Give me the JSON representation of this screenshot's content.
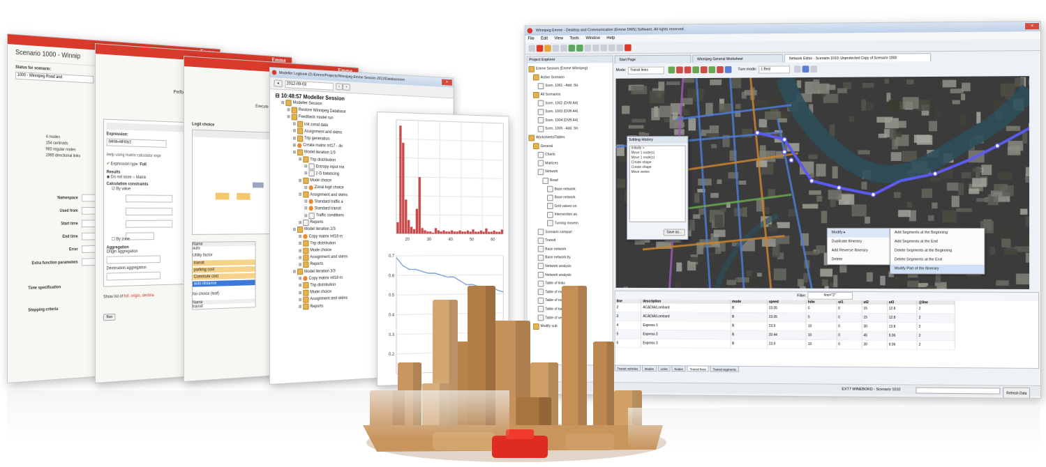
{
  "scenario_panel": {
    "title": "Scenario 1000 - Winnip",
    "status_label": "Status for scenario:",
    "status_value": "1000 - Winnipeg Road and",
    "stats": [
      "4 modes",
      "154 centroids",
      "983 regular nodes",
      "2995 directional links"
    ],
    "fields": [
      "Namespace",
      "Used from",
      "Start time",
      "End time",
      "Error",
      "Extra function parameters"
    ],
    "time_spec": "Time specification",
    "stopping": "Stopping criteria",
    "logo": "Emme"
  },
  "matrix_panel": {
    "header": "Perform matrix calculation",
    "expression_label": "Expression:",
    "expression_value": "(MF68+MF69)/2",
    "help_text": "Help using matrix calculator expr",
    "expression_type": "Expression type:",
    "expression_type_value": "Full",
    "results_label": "Results",
    "result_options": [
      "Do not store",
      "Matrix"
    ],
    "constraints_label": "Calculation constraints",
    "by_value": "By value",
    "by_zone": "By zone",
    "aggregation_label": "Aggregation",
    "origin_agg": "Origin aggregation",
    "dest_agg": "Destination aggregation",
    "footer": "Show list of",
    "footer_links": "full, origin, destina",
    "run_button": "Run"
  },
  "logit_panel": {
    "header": "Execute zonal aggregat",
    "logit_label": "Logit choice",
    "name_col": "Name",
    "auto": "auto",
    "utility": "Utility factor",
    "items": [
      "transit",
      "parking cost",
      "Commute cost",
      "auto distance"
    ],
    "no_choice": "No choice (leaf)",
    "name2": "Name",
    "transit2": "transit"
  },
  "logbook": {
    "title": "Modeller Logbook (D:/Emme/Projects/Winnipeg Emme Session 2012/Database/em",
    "date": "2012-09-03",
    "session": "10:48:57 Modeller Session",
    "rows": [
      {
        "indent": 1,
        "icon": "fold",
        "text": "Modeller Session"
      },
      {
        "indent": 2,
        "icon": "fold",
        "text": "Restore Winnipeg Database"
      },
      {
        "indent": 2,
        "icon": "fold",
        "text": "Feedback model run"
      },
      {
        "indent": 3,
        "icon": "fold",
        "text": "Init zonal data"
      },
      {
        "indent": 3,
        "icon": "fold",
        "text": "Assignment and skims"
      },
      {
        "indent": 3,
        "icon": "fold",
        "text": "Trip generation"
      },
      {
        "indent": 3,
        "icon": "tool",
        "text": "Create matrix mf17 - de"
      },
      {
        "indent": 3,
        "icon": "fold",
        "text": "Model iteration 1/3"
      },
      {
        "indent": 4,
        "icon": "fold",
        "text": "Trip distribution"
      },
      {
        "indent": 5,
        "icon": "box",
        "text": "Entropy input ma"
      },
      {
        "indent": 5,
        "icon": "box",
        "text": "2-D balancing"
      },
      {
        "indent": 4,
        "icon": "fold",
        "text": "Mode choice"
      },
      {
        "indent": 5,
        "icon": "tool",
        "text": "Zonal logit choice"
      },
      {
        "indent": 4,
        "icon": "fold",
        "text": "Assignment and skims"
      },
      {
        "indent": 5,
        "icon": "tool",
        "text": "Standard traffic a"
      },
      {
        "indent": 5,
        "icon": "tool",
        "text": "Standard transit"
      },
      {
        "indent": 5,
        "icon": "box",
        "text": "Traffic conditions"
      },
      {
        "indent": 4,
        "icon": "box",
        "text": "Reports"
      },
      {
        "indent": 3,
        "icon": "fold",
        "text": "Model iteration 2/3"
      },
      {
        "indent": 4,
        "icon": "tool",
        "text": "Copy matrix mf18 m"
      },
      {
        "indent": 4,
        "icon": "fold",
        "text": "Trip distribution"
      },
      {
        "indent": 4,
        "icon": "fold",
        "text": "Mode choice"
      },
      {
        "indent": 4,
        "icon": "fold",
        "text": "Assignment and skims"
      },
      {
        "indent": 4,
        "icon": "fold",
        "text": "Reports"
      },
      {
        "indent": 3,
        "icon": "fold",
        "text": "Model iteration 3/3"
      },
      {
        "indent": 4,
        "icon": "tool",
        "text": "Copy matrix mf18 m"
      },
      {
        "indent": 4,
        "icon": "fold",
        "text": "Trip distribution"
      },
      {
        "indent": 4,
        "icon": "fold",
        "text": "Mode choice"
      },
      {
        "indent": 4,
        "icon": "fold",
        "text": "Assignment and skims"
      },
      {
        "indent": 4,
        "icon": "fold",
        "text": "Reports"
      }
    ]
  },
  "chart_data": [
    {
      "type": "bar",
      "x_ticks": [
        "20",
        "30",
        "40",
        "50",
        "60"
      ],
      "values": [
        0.1,
        0.95,
        0.8,
        0.3,
        0.12,
        0.06,
        0.04,
        0.22,
        0.5,
        0.05,
        0.03,
        0.02,
        0.02,
        0.01,
        0.05,
        0.03,
        0.02,
        0.03,
        0.02,
        0.02,
        0.03,
        0.02,
        0.02,
        0.03,
        0.02,
        0.02,
        0.03,
        0.02,
        0.04,
        0.02,
        0.02,
        0.03,
        0.02,
        0.05,
        0.02,
        0.02,
        0.03,
        0.02,
        0.02,
        0.04
      ],
      "color": "#c94a4a"
    },
    {
      "type": "line",
      "y_ticks": [
        "0.7",
        "0.6",
        "0.5",
        "0.4",
        "0.3",
        "0.2"
      ],
      "values": [
        0.74,
        0.7,
        0.68,
        0.68,
        0.67,
        0.66,
        0.66,
        0.65,
        0.64,
        0.64,
        0.62,
        0.6,
        0.6,
        0.59,
        0.58,
        0.59,
        0.57,
        0.56
      ],
      "color": "#7a9fd4"
    }
  ],
  "desktop": {
    "title": "Winnipeg Emme - Desktop and Communication (Emme DMS) Software. All rights reserved.",
    "menu": [
      "File",
      "Edit",
      "View",
      "Tools",
      "Window",
      "Help"
    ],
    "tabs": [
      "Start Page",
      "Winnipeg General Worksheet",
      "Network Editor - Scenario 1010: Unprotected Copy of Scenario 1000"
    ],
    "explorer_title": "Project Explorer",
    "tree": [
      {
        "indent": 0,
        "text": "Emme Session (Emme Winnipeg)"
      },
      {
        "indent": 1,
        "text": "Active Scenario"
      },
      {
        "indent": 2,
        "text": "Scen. 1001 - Add. Str."
      },
      {
        "indent": 1,
        "text": "All Scenarios"
      },
      {
        "indent": 2,
        "text": "Scen. 1002 (DVB A4)"
      },
      {
        "indent": 2,
        "text": "Scen. 1003 (DVB A4)"
      },
      {
        "indent": 2,
        "text": "Scen. 1004 (DVB A4)"
      },
      {
        "indent": 2,
        "text": "Scen. 1005 - Add. Str."
      },
      {
        "indent": 0,
        "text": "Worksheets/Tables"
      },
      {
        "indent": 1,
        "text": "General"
      },
      {
        "indent": 2,
        "text": "Charts"
      },
      {
        "indent": 2,
        "text": "Matrices"
      },
      {
        "indent": 2,
        "text": "Network"
      },
      {
        "indent": 3,
        "text": "Road"
      },
      {
        "indent": 4,
        "text": "Base network"
      },
      {
        "indent": 4,
        "text": "Base network"
      },
      {
        "indent": 4,
        "text": "Grid values on"
      },
      {
        "indent": 4,
        "text": "Intersection an"
      },
      {
        "indent": 4,
        "text": "Turning movem"
      },
      {
        "indent": 2,
        "text": "Scenario compari"
      },
      {
        "indent": 2,
        "text": "Transit"
      },
      {
        "indent": 2,
        "text": "Base network"
      },
      {
        "indent": 2,
        "text": "Base network by"
      },
      {
        "indent": 2,
        "text": "Network analysis"
      },
      {
        "indent": 2,
        "text": "Network analysis"
      },
      {
        "indent": 2,
        "text": "Table of links"
      },
      {
        "indent": 2,
        "text": "Table of modes"
      },
      {
        "indent": 2,
        "text": "Table of nodes"
      },
      {
        "indent": 2,
        "text": "Table of turns"
      },
      {
        "indent": 2,
        "text": "Table of vehicles"
      },
      {
        "indent": 1,
        "text": "Modify sub"
      }
    ],
    "toolbar_mode_label": "Mode:",
    "toolbar_mode_value": "Transit lines",
    "turn_label": "Turn mode:",
    "turn_value": "1 Best",
    "editing_history_title": "Editing History",
    "editing_history": [
      "Initially >",
      "Move 1 node(s)",
      "Move 1 node(s)",
      "Create shape",
      "Create shape",
      "Move vertex"
    ],
    "save_button": "Save as...",
    "context_menu": [
      "Modify",
      "Duplicate Itinerary",
      "Add Reverse Itinerary",
      "Delete"
    ],
    "submenu": [
      "Add Segments at the Beginning",
      "Add Segments at the End",
      "Delete Segments at the Beginning",
      "Delete Segments at the End",
      "Modify Part of the Itinerary"
    ],
    "filter_label": "Filter:",
    "filter_value": "line=\"2\"",
    "table_cols": [
      "line",
      "description",
      "mode",
      "speed",
      "hdw",
      "ut1",
      "ut2",
      "ut3",
      "@line"
    ],
    "table_rows": [
      [
        "2",
        "ACADIA/Lombard",
        "B",
        "23.05",
        "5",
        "0",
        "15",
        "12.8",
        "2"
      ],
      [
        "3",
        "ACADIA/Lombard",
        "B",
        "23.05",
        "5",
        "0",
        "15",
        "12.8",
        "2"
      ],
      [
        "4",
        "Express 1",
        "B",
        "23.9",
        "10",
        "0",
        "30",
        "13.8",
        "2"
      ],
      [
        "5",
        "Express 2",
        "B",
        "20.44",
        "10",
        "0",
        "45",
        "9.06",
        "2"
      ],
      [
        "6",
        "Express 3",
        "B",
        "23.9",
        "10",
        "0",
        "30",
        "9.06",
        "2"
      ]
    ],
    "bottom_tabs": [
      "Transit vehicles",
      "Modes",
      "Links",
      "Nodes",
      "Transit lines",
      "Transit segments"
    ],
    "status": "EXT7 WINEBOKD - Scenario 1010",
    "refresh": "Refresh Data",
    "colors": {
      "map": "#3b3b3b",
      "river": "#2e4f5a",
      "route": "#5b5bf0",
      "road_blue": "#4f7bd4",
      "road_orange": "#c8842e",
      "road_green": "#6aa84f",
      "road_purple": "#9b59b6"
    }
  },
  "emme_logo": "Emme"
}
